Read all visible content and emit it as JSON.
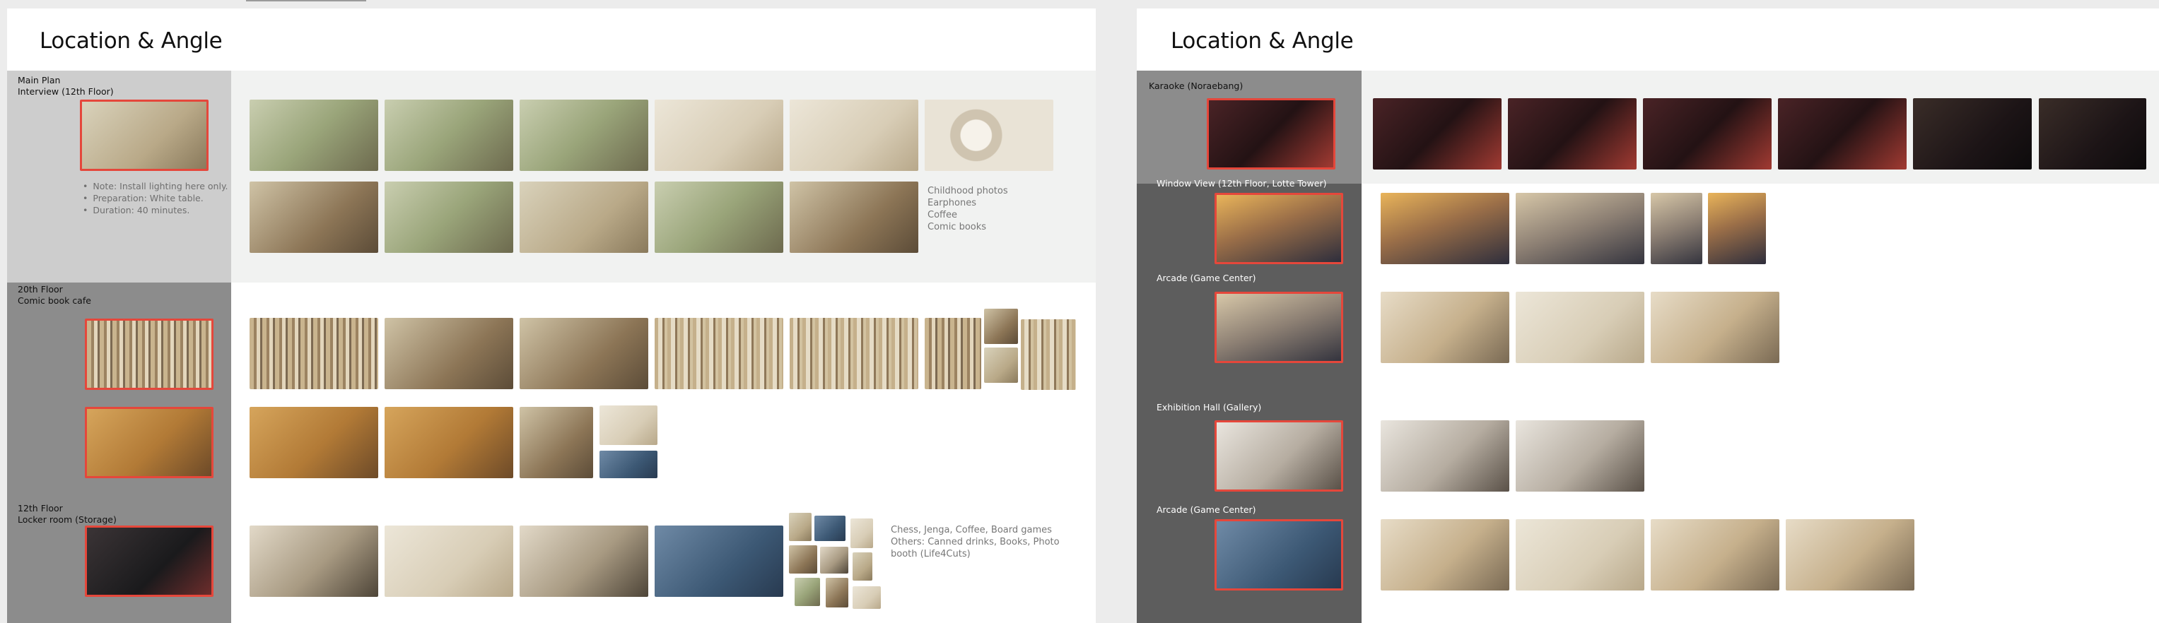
{
  "left_board": {
    "title": "Location & Angle",
    "sections": [
      {
        "label_line1": "Main Plan",
        "label_line2": "Interview (12th Floor)",
        "notes": [
          "Note: Install lighting here only.",
          "Preparation: White table.",
          "Duration: 40 minutes."
        ],
        "props": [
          "Childhood photos",
          "Earphones",
          "Coffee",
          "Comic books"
        ]
      },
      {
        "label_line1": "20th Floor",
        "label_line2": "Comic book cafe"
      },
      {
        "label_line1": "12th Floor",
        "label_line2": "Locker room (Storage)",
        "props_text": "Chess, Jenga, Coffee, Board games Others: Canned drinks, Books, Photo booth (Life4Cuts)"
      }
    ]
  },
  "right_board": {
    "title": "Location & Angle",
    "sections": [
      {
        "label": "Karaoke (Noraebang)"
      },
      {
        "label": "Window View (12th Floor, Lotte Tower)"
      },
      {
        "label": "Arcade (Game Center)"
      },
      {
        "label": "Exhibition Hall (Gallery)"
      },
      {
        "label": "Arcade (Game Center)"
      }
    ]
  },
  "colors": {
    "selection_border": "#e5473b",
    "band_light": "#f1f2f1",
    "label_col_light": "#cdcdcd",
    "label_col_mid": "#8c8c8c",
    "label_col_dark": "#5d5d5d"
  }
}
